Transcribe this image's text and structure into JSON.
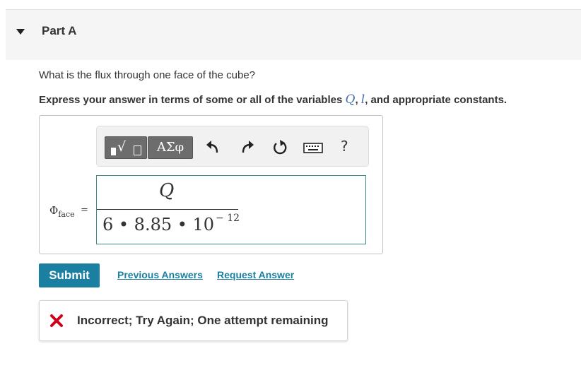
{
  "part": {
    "title": "Part A"
  },
  "question": {
    "text": "What is the flux through one face of the cube?",
    "instruction_prefix": "Express your answer in terms of some or all of the variables ",
    "var_q": "Q",
    "sep": ", ",
    "var_l": "l",
    "instruction_suffix": ", and appropriate constants."
  },
  "toolbar": {
    "greek_label": "ΑΣφ",
    "sqrt_glyph": "√",
    "help_label": "?"
  },
  "answer": {
    "phi_symbol": "Φ",
    "phi_subscript": "face",
    "equals": "=",
    "numerator": "Q",
    "denominator_base": "6 • 8.85 • 10",
    "denominator_exponent": "− 12"
  },
  "actions": {
    "submit_label": "Submit",
    "previous_answers_label": "Previous Answers",
    "request_answer_label": "Request Answer"
  },
  "feedback": {
    "text": "Incorrect; Try Again; One attempt remaining",
    "icon": "x-icon",
    "color": "#d0021b"
  },
  "colors": {
    "accent": "#1a7fa0",
    "math_variable": "#4a6ea8",
    "input_border": "#3a8a8a"
  }
}
